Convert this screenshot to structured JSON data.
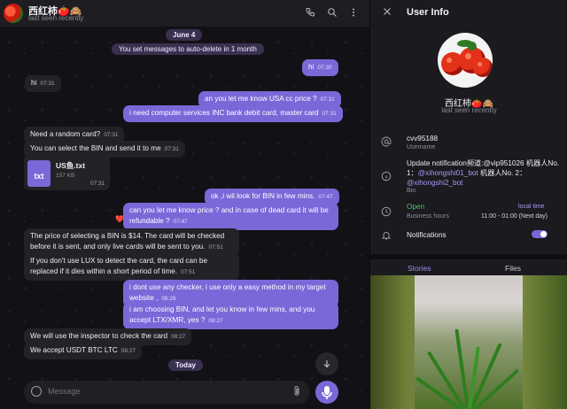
{
  "chat": {
    "title": "西红柿🍅🙈",
    "status": "last seen recently",
    "composer_placeholder": "Message",
    "messages": [
      {
        "kind": "date",
        "text": "June 4"
      },
      {
        "kind": "system",
        "text": "You set messages to auto-delete in 1 month"
      },
      {
        "kind": "out",
        "text": "hi",
        "time": "07:30"
      },
      {
        "kind": "in",
        "text": "hi",
        "time": "07:31"
      },
      {
        "kind": "out",
        "text": "an you let me know USA cc price ?",
        "time": "07:31"
      },
      {
        "kind": "out",
        "text": "i need computer services INC bank debit card, master card",
        "time": "07:31"
      },
      {
        "kind": "in",
        "text": "Need a random card?",
        "time": "07:31"
      },
      {
        "kind": "in",
        "text": "You can select the BIN and send it to me",
        "time": "07:31"
      },
      {
        "kind": "file",
        "name": "US鱼.txt",
        "size": "157 KB",
        "icon": "txt",
        "time": "07:31"
      },
      {
        "kind": "out",
        "text": "ok ,i wil look for BIN in few mins.",
        "time": "07:47"
      },
      {
        "kind": "out",
        "text": "can you let me know price ? and in case of dead card it will be refundable ?",
        "time": "07:47",
        "reaction": "❤️"
      },
      {
        "kind": "in",
        "text": "The price of selecting a BIN is $14. The card will be checked before it is sent, and only live cards will be sent to you.",
        "time": "07:51"
      },
      {
        "kind": "in",
        "text": "If you don't use LUX to detect the card, the card can be replaced if it dies within a short period of time.",
        "time": "07:51"
      },
      {
        "kind": "out",
        "text": "i dont  use any checker, i use only a easy method in my target website ,",
        "time": "08:26"
      },
      {
        "kind": "out",
        "text": "i am choosing BIN, and let you know in few mins, and you accept LTX/XMR, yes ?",
        "time": "08:27"
      },
      {
        "kind": "in",
        "text": "We will use the inspector to check the card",
        "time": "08:27"
      },
      {
        "kind": "in",
        "text": "We accept USDT BTC LTC",
        "time": "08:27"
      },
      {
        "kind": "date",
        "text": "Today"
      }
    ]
  },
  "info": {
    "title": "User Info",
    "name": "西红柿🍅🙈",
    "status": "last seen recently",
    "username": "cvv95188",
    "username_label": "Username",
    "bio_prefix": "Update notification频道:@vip951026 机器人No. 1：",
    "bio_link1": "@xihongshi01_bot",
    "bio_mid": " 机器人No. 2：",
    "bio_link2": "@xihongshi2_bot",
    "bio_label": "Bio",
    "open_status": "Open",
    "local_time": "local time",
    "hours_label": "Business hours",
    "hours": "11:00 - 01:00 (Next day)",
    "notifications": "Notifications",
    "notifications_on": true,
    "tabs": [
      "Stories",
      "Files"
    ]
  },
  "colors": {
    "accent": "#7b67d8",
    "bg": "#121216",
    "panel": "#1a1a1f",
    "open": "#4fc36b"
  }
}
